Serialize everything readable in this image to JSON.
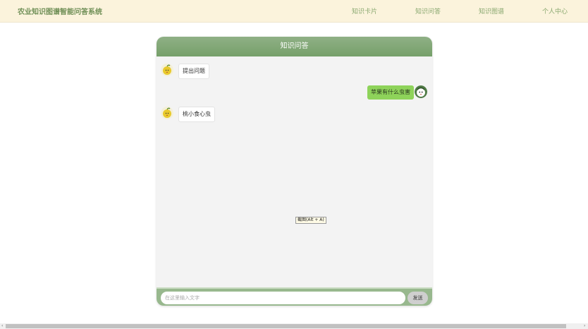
{
  "header": {
    "brand": "农业知识图谱智能问答系统",
    "nav": [
      {
        "label": "知识卡片"
      },
      {
        "label": "知识问答"
      },
      {
        "label": "知识图谱"
      },
      {
        "label": "个人中心"
      }
    ]
  },
  "chat": {
    "title": "知识问答",
    "messages": [
      {
        "role": "bot",
        "text": "提出问题"
      },
      {
        "role": "user",
        "text": "苹果有什么虫害"
      },
      {
        "role": "bot",
        "text": "桃小食心虫"
      }
    ],
    "input": {
      "placeholder": "在这里输入文字",
      "value": ""
    },
    "send_label": "发送"
  },
  "tooltip": "截图(Alt + A)",
  "scrollbar": {
    "left_arrow": "‹",
    "right_arrow": "›"
  },
  "colors": {
    "topbar_bg": "#fbf3dc",
    "brand": "#6f8f56",
    "header_green": "#76a06a",
    "user_bubble": "#8ed35a"
  }
}
